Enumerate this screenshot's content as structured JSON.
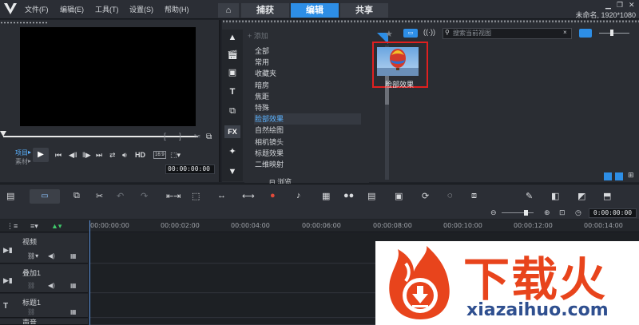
{
  "menu": [
    "文件(F)",
    "编辑(E)",
    "工具(T)",
    "设置(S)",
    "帮助(H)"
  ],
  "tabs": [
    "捕获",
    "编辑",
    "共享"
  ],
  "active_tab": "编辑",
  "project_info": "未命名, 1920*1080",
  "player": {
    "mode_project": "项目",
    "mode_clip": "素材",
    "hd_label": "HD",
    "aspect_label": "16:9",
    "timecode": "00:00:00:00"
  },
  "library": {
    "add_label": "添加",
    "categories": [
      "全部",
      "常用",
      "收藏夹",
      "暗房",
      "焦距",
      "特殊",
      "脸部效果",
      "自然绘图",
      "相机镜头",
      "标题效果",
      "二维映射"
    ],
    "selected_category": "脸部效果",
    "browse_label": "浏览",
    "search_placeholder": "搜索当前视图",
    "thumbnail_label": "脸部效果",
    "side_icons": [
      "up-arrow",
      "media",
      "instant-project",
      "title",
      "transition",
      "fx",
      "graphics",
      "down-arrow"
    ]
  },
  "timeline": {
    "timecode": "0:00:00:00",
    "ruler_labels": [
      "00:00:00:00",
      "00:00:02:00",
      "00:00:04:00",
      "00:00:06:00",
      "00:00:08:00",
      "00:00:10:00",
      "00:00:12:00",
      "00:00:14:00"
    ],
    "tracks": [
      "视频",
      "叠加1",
      "标题1",
      "声音"
    ]
  },
  "watermark": {
    "title": "下载火",
    "subtitle": "xiazaihuo.com"
  },
  "colors": {
    "accent": "#2d8ee6",
    "selection_border": "#e02020",
    "watermark_orange": "#e8441c"
  }
}
